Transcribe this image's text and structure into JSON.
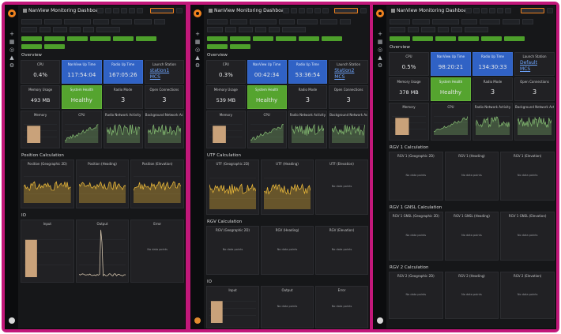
{
  "screens": [
    {
      "title": "NanView Monitoring Dashboard",
      "overview_label": "Overview",
      "cpu": {
        "label": "CPU",
        "value": "0.4%"
      },
      "runtime": {
        "label": "NanView Up Time",
        "value": "117:54:04"
      },
      "radio_uptime": {
        "label": "Radio Up Time",
        "value": "167:05:26"
      },
      "station": {
        "label": "Launch Station",
        "value_line1": "station1",
        "value_line2": "MCS"
      },
      "memory": {
        "label": "Memory Usage",
        "value": "493 MB"
      },
      "health": {
        "label": "System Health",
        "value": "Healthy"
      },
      "radio_mode": {
        "label": "Radio Mode",
        "value": "3"
      },
      "open_conn": {
        "label": "Open Connections",
        "value": "3"
      },
      "section2": "Position Calculation",
      "section3": "IO",
      "charts_row1": [
        "Memory",
        "CPU",
        "Radio Network Activity",
        "Background Network Activity"
      ],
      "charts_row2": [
        "Position (Geographic 2D)",
        "Position (Heading)",
        "Position (Elevation)"
      ],
      "charts_row3": [
        "Input",
        "Output",
        "Error"
      ],
      "no_data": "No data points"
    },
    {
      "title": "NanView Monitoring Dashboard",
      "overview_label": "Overview",
      "cpu": {
        "label": "CPU",
        "value": "0.3%"
      },
      "runtime": {
        "label": "NanView Up Time",
        "value": "00:42:34"
      },
      "radio_uptime": {
        "label": "Radio Up Time",
        "value": "53:36:54"
      },
      "station": {
        "label": "Launch Station",
        "value_line1": "Station2",
        "value_line2": "MCS"
      },
      "memory": {
        "label": "Memory Usage",
        "value": "539 MB"
      },
      "health": {
        "label": "System Health",
        "value": "Healthy"
      },
      "radio_mode": {
        "label": "Radio Mode",
        "value": "3"
      },
      "open_conn": {
        "label": "Open Connections",
        "value": "3"
      },
      "section2": "UTF Calculation",
      "section3": "RGV Calculation",
      "section4": "IO",
      "charts_row1": [
        "Memory",
        "CPU",
        "Radio Network Activity",
        "Background Network Activity"
      ],
      "charts_row2": [
        "UTF (Geographic 2D)",
        "UTF (Heading)",
        "UTF (Elevation)"
      ],
      "charts_row3": [
        "RGV (Geographic 2D)",
        "RGV (Heading)",
        "RGV (Elevation)"
      ],
      "charts_row4": [
        "Input",
        "Output",
        "Error"
      ],
      "no_data": "No data points"
    },
    {
      "title": "NanView Monitoring Dashboard",
      "overview_label": "Overview",
      "cpu": {
        "label": "CPU",
        "value": "0.5%"
      },
      "runtime": {
        "label": "NanView Up Time",
        "value": "98:20:21"
      },
      "radio_uptime": {
        "label": "Radio Up Time",
        "value": "134:30:33"
      },
      "station": {
        "label": "Launch Station",
        "value_line1": "Default",
        "value_line2": "MCS"
      },
      "memory": {
        "label": "Memory Usage",
        "value": "378 MB"
      },
      "health": {
        "label": "System Health",
        "value": "Healthy"
      },
      "radio_mode": {
        "label": "Radio Mode",
        "value": "3"
      },
      "open_conn": {
        "label": "Open Connections",
        "value": "3"
      },
      "section2": "RGV 1 Calculation",
      "section3": "RGV 1 GNSL Calculation",
      "section4": "RGV 2 Calculation",
      "charts_row1": [
        "Memory",
        "CPU",
        "Radio Network Activity",
        "Background Network Activity"
      ],
      "charts_row2": [
        "RGV 1 (Geographic 2D)",
        "RGV 1 (Heading)",
        "RGV 1 (Elevation)"
      ],
      "charts_row3": [
        "RGV 1 GNSL (Geographic 2D)",
        "RGV 1 GNSL (Heading)",
        "RGV 1 GNSL (Elevation)"
      ],
      "charts_row4": [
        "RGV 2 (Geographic 2D)",
        "RGV 2 (Heading)",
        "RGV 2 (Elevation)"
      ],
      "no_data": "No data points"
    }
  ],
  "colors": {
    "frame": "#c2187a",
    "bg": "#161719",
    "panel": "#212124",
    "blue": "#3062c5",
    "green": "#55a42f",
    "series_green": "#7eb26d",
    "series_yellow": "#eab839",
    "memory_fill": "#c9a27a"
  }
}
